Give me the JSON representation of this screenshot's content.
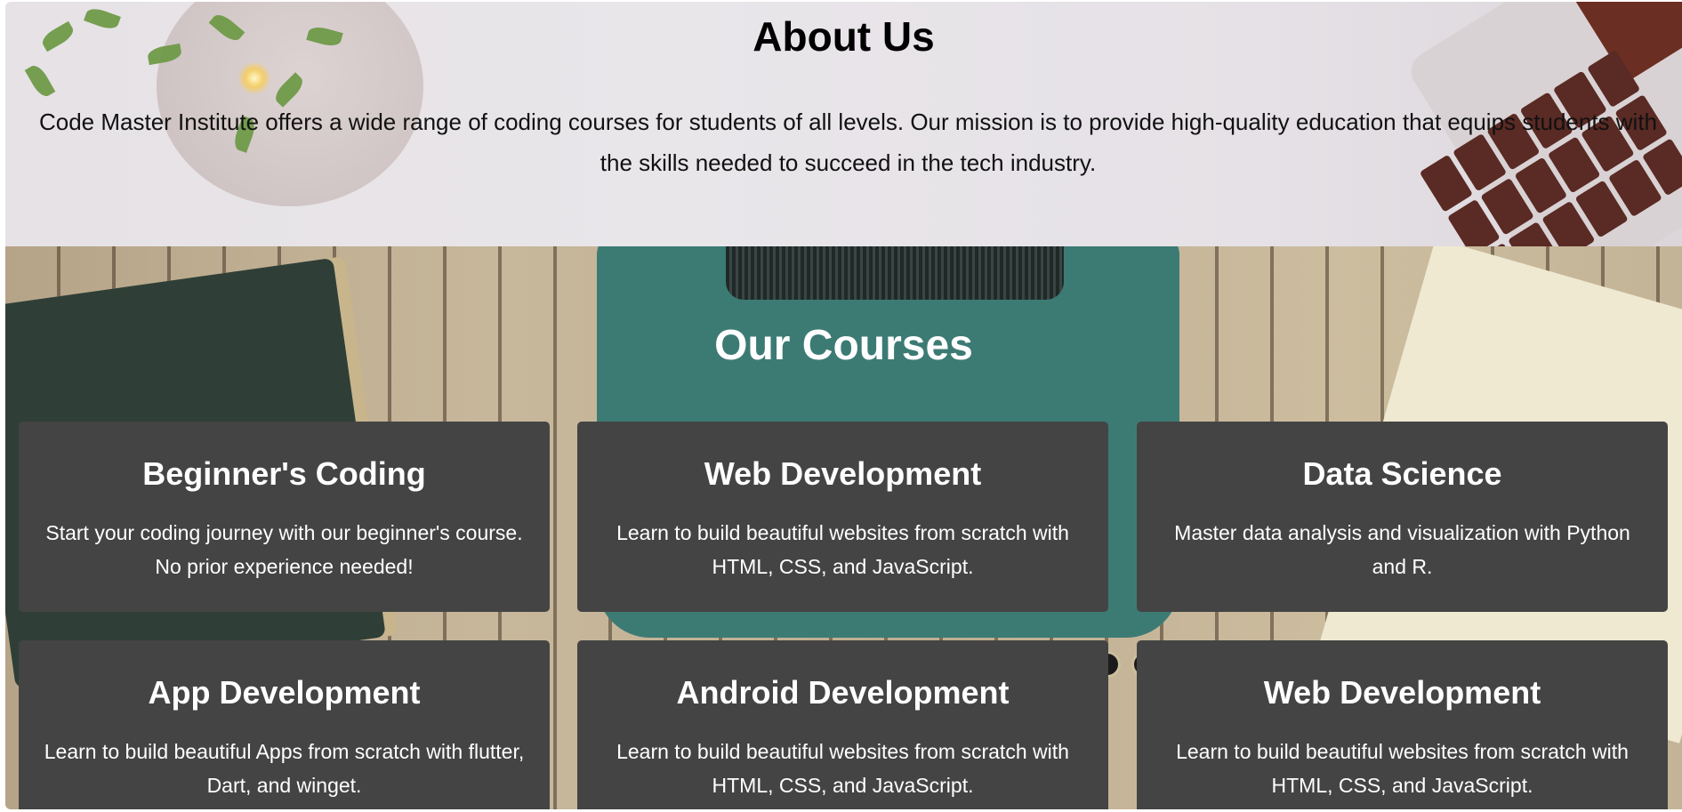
{
  "about": {
    "title": "About Us",
    "text": "Code Master Institute offers a wide range of coding courses for students of all levels. Our mission is to provide high-quality education that equips students with the skills needed to succeed in the tech industry."
  },
  "courses": {
    "title": "Our Courses",
    "items": [
      {
        "title": "Beginner's Coding",
        "description": "Start your coding journey with our beginner's course. No prior experience needed!"
      },
      {
        "title": "Web Development",
        "description": "Learn to build beautiful websites from scratch with HTML, CSS, and JavaScript."
      },
      {
        "title": "Data Science",
        "description": "Master data analysis and visualization with Python and R."
      },
      {
        "title": "App Development",
        "description": "Learn to build beautiful Apps from scratch with flutter, Dart, and winget."
      },
      {
        "title": "Android Development",
        "description": "Learn to build beautiful websites from scratch with HTML, CSS, and JavaScript."
      },
      {
        "title": "Web Development",
        "description": "Learn to build beautiful websites from scratch with HTML, CSS, and JavaScript."
      }
    ]
  },
  "colors": {
    "card_background": "#444444",
    "card_text": "#ffffff",
    "about_background": "#e8e4e8"
  }
}
